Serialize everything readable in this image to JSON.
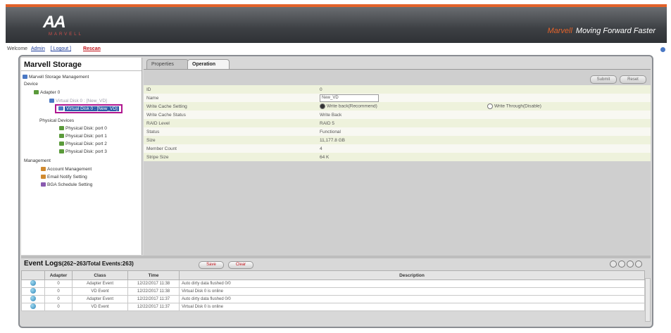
{
  "header": {
    "logo_mark": "AA",
    "logo_text": "MARVELL",
    "tagline_brand": "Marvell",
    "tagline": "Moving Forward Faster"
  },
  "topbar": {
    "welcome": "Welcome",
    "user": "Admin",
    "logout": "[ Logout ]",
    "rescan": "Rescan"
  },
  "tree": {
    "title": "Marvell Storage",
    "nodes": [
      {
        "label": "Marvell Storage Management",
        "icon": "storage-icon"
      },
      {
        "label": "Device",
        "icon": "folder-icon"
      },
      {
        "label": "Adapter 0",
        "icon": "adapter-icon"
      },
      {
        "label": "Virtual Disk 0 : [New_VD]",
        "icon": "virtual-disk-icon"
      },
      {
        "label": "Virtual Disk 0 : [New_VD]",
        "icon": "virtual-disk-icon"
      },
      {
        "label": "Physical Devices",
        "icon": "folder-icon"
      },
      {
        "label": "Physical Disk: port 0",
        "icon": "disk-icon"
      },
      {
        "label": "Physical Disk: port 1",
        "icon": "disk-icon"
      },
      {
        "label": "Physical Disk: port 2",
        "icon": "disk-icon"
      },
      {
        "label": "Physical Disk: port 3",
        "icon": "disk-icon"
      },
      {
        "label": "Management",
        "icon": "folder-icon"
      },
      {
        "label": "Account Management",
        "icon": "account-icon"
      },
      {
        "label": "Email Notify Setting",
        "icon": "email-icon"
      },
      {
        "label": "BGA Schedule Setting",
        "icon": "schedule-icon"
      }
    ]
  },
  "tabs": [
    "Properties",
    "Operation"
  ],
  "toolbar": {
    "submit": "Submit",
    "reset": "Reset"
  },
  "properties": {
    "id_label": "ID",
    "id_value": "0",
    "name_label": "Name",
    "name_value": "New_VD",
    "wcs_label": "Write Cache Setting",
    "wcs_opt1": "Write back(Recommend)",
    "wcs_opt2": "Write Through(Disable)",
    "wcstatus_label": "Write Cache Status",
    "wcstatus_value": "Write Back",
    "raid_label": "RAID Level",
    "raid_value": "RAID 5",
    "status_label": "Status",
    "status_value": "Functional",
    "size_label": "Size",
    "size_value": "11,177.8 GB",
    "member_label": "Member Count",
    "member_value": "4",
    "stripe_label": "Stripe Size",
    "stripe_value": "64 K"
  },
  "events": {
    "title": "Event Logs",
    "count_text": "(262~263/Total Events:263)",
    "save_label": "Save",
    "clear_label": "Clear",
    "columns": [
      "",
      "Adapter",
      "Class",
      "Time",
      "Description"
    ],
    "rows": [
      {
        "adapter": "0",
        "class": "Adapter Event",
        "time": "12/22/2017 11:38",
        "desc": "Auto dirty data flushed 0/0"
      },
      {
        "adapter": "0",
        "class": "VD Event",
        "time": "12/22/2017 11:38",
        "desc": "Virtual Disk 0 is online"
      },
      {
        "adapter": "0",
        "class": "Adapter Event",
        "time": "12/22/2017 11:37",
        "desc": "Auto dirty data flushed 0/0"
      },
      {
        "adapter": "0",
        "class": "VD Event",
        "time": "12/22/2017 11:37",
        "desc": "Virtual Disk 0 is online"
      }
    ]
  },
  "colors": {
    "accent": "#e2622a",
    "header_bg": "#3d4044",
    "row_highlight": "#eef2dc",
    "selection_border": "#b0168f"
  }
}
